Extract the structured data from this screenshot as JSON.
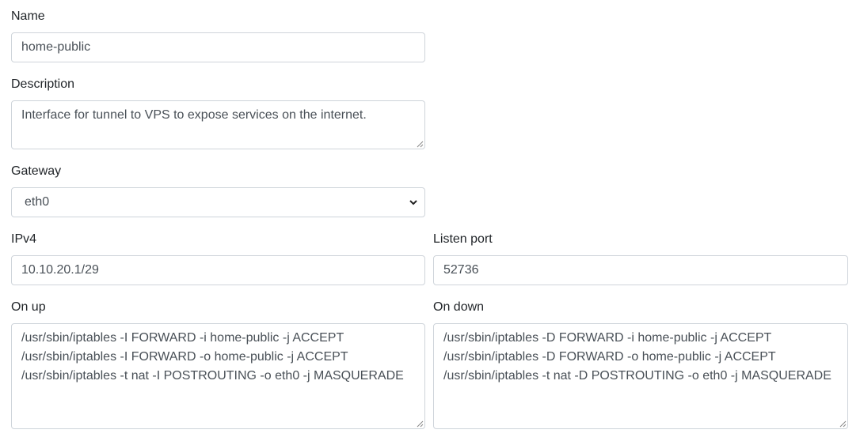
{
  "form": {
    "name": {
      "label": "Name",
      "value": "home-public"
    },
    "description": {
      "label": "Description",
      "value": "Interface for tunnel to VPS to expose services on the internet."
    },
    "gateway": {
      "label": "Gateway",
      "selected": "eth0"
    },
    "ipv4": {
      "label": "IPv4",
      "value": "10.10.20.1/29"
    },
    "listen_port": {
      "label": "Listen port",
      "value": "52736"
    },
    "on_up": {
      "label": "On up",
      "lines": [
        "/usr/sbin/iptables -I FORWARD -i home-public -j ACCEPT",
        "/usr/sbin/iptables -I FORWARD -o home-public -j ACCEPT",
        "/usr/sbin/iptables -t nat -I POSTROUTING -o eth0 -j MASQUERADE"
      ]
    },
    "on_down": {
      "label": "On down",
      "lines": [
        "/usr/sbin/iptables -D FORWARD -i home-public -j ACCEPT",
        "/usr/sbin/iptables -D FORWARD -o home-public -j ACCEPT",
        "/usr/sbin/iptables -t nat -D POSTROUTING -o eth0 -j MASQUERADE"
      ]
    }
  }
}
